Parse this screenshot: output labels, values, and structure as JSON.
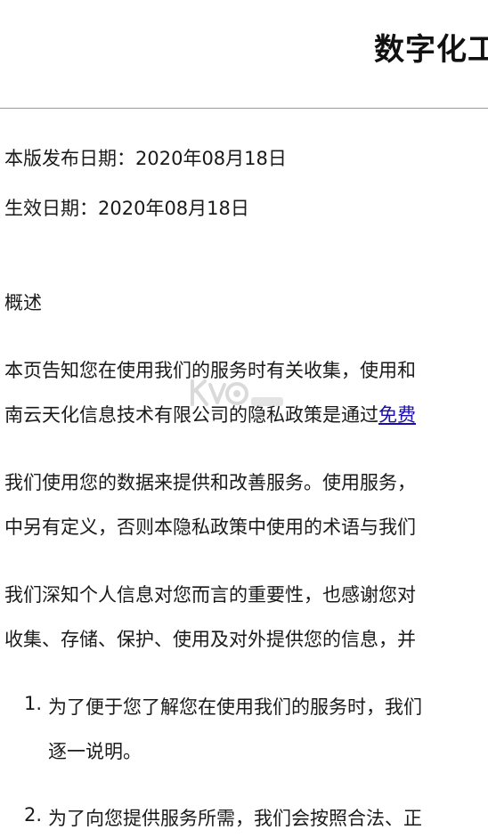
{
  "header": {
    "title": "数字化工"
  },
  "meta": {
    "release_date": "本版发布日期：2020年08月18日",
    "effective_date": "生效日期：2020年08月18日"
  },
  "overview": {
    "heading": "概述"
  },
  "paragraphs": {
    "p1_line1": "本页告知您在使用我们的服务时有关收集，使用和",
    "p1_line2_prefix": "南云天化信息技术有限公司的隐私政策是通过",
    "p1_link": "免费",
    "p2_line1": "我们使用您的数据来提供和改善服务。使用服务，",
    "p2_line2": "中另有定义，否则本隐私政策中使用的术语与我们",
    "p3_line1": "我们深知个人信息对您而言的重要性，也感谢您对",
    "p3_line2": "收集、存储、保护、使用及对外提供您的信息，并"
  },
  "list": {
    "item1_number": "1.",
    "item1_line1": "为了便于您了解您在使用我们的服务时，我们",
    "item1_line2": "逐一说明。",
    "item2_number": "2.",
    "item2_line1": "为了向您提供服务所需，我们会按照合法、正"
  },
  "colors": {
    "link": "#1a0dab",
    "text": "#1a1a1a",
    "divider": "#9a9a9a"
  }
}
